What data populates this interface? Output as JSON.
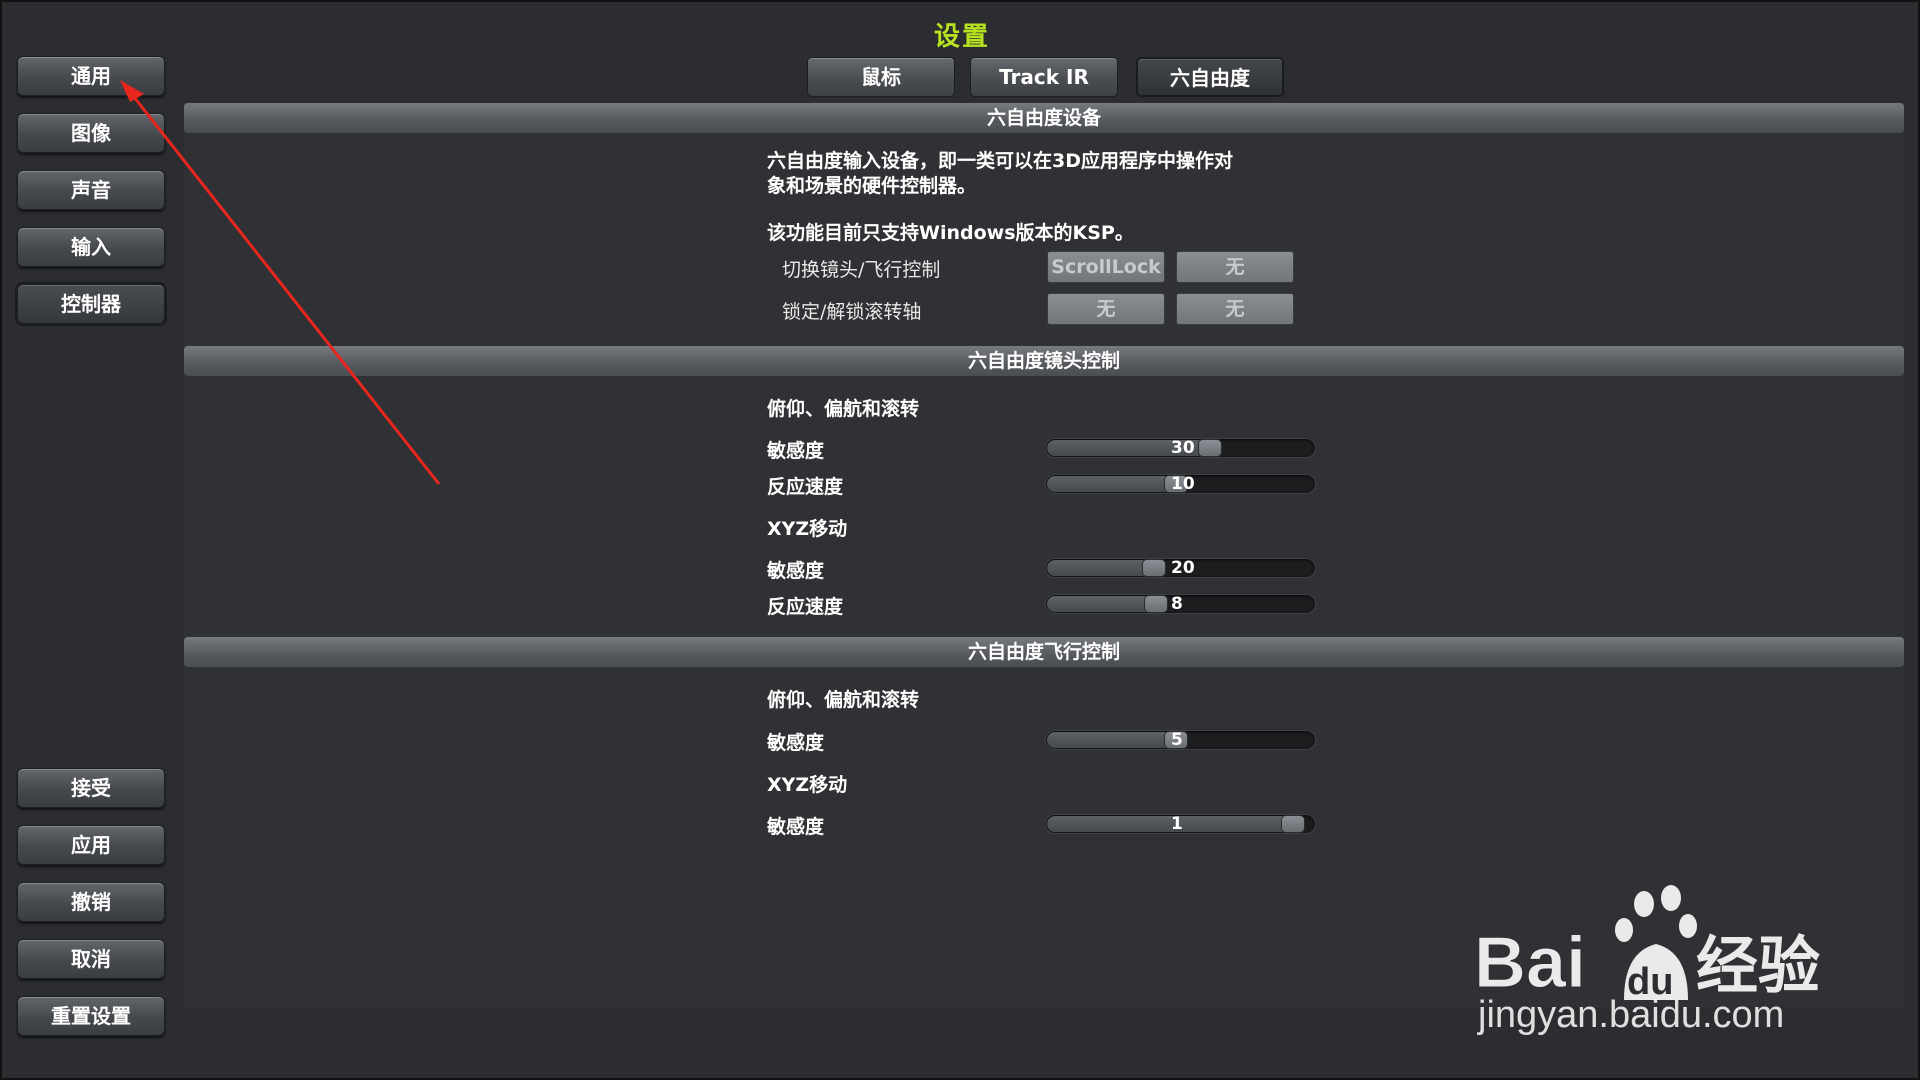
{
  "window": {
    "title": "设置"
  },
  "sidebar": {
    "items": [
      {
        "label": "通用"
      },
      {
        "label": "图像"
      },
      {
        "label": "声音"
      },
      {
        "label": "输入"
      },
      {
        "label": "控制器"
      }
    ],
    "actions": [
      {
        "label": "接受"
      },
      {
        "label": "应用"
      },
      {
        "label": "撤销"
      },
      {
        "label": "取消"
      },
      {
        "label": "重置设置"
      }
    ]
  },
  "tabs": [
    {
      "label": "鼠标"
    },
    {
      "label": "Track IR"
    },
    {
      "label": "六自由度",
      "active": true
    }
  ],
  "device_section": {
    "header": "六自由度设备",
    "desc_line1": "六自由度输入设备，即一类可以在3D应用程序中操作对",
    "desc_line2": "象和场景的硬件控制器。",
    "note": "该功能目前只支持Windows版本的KSP。",
    "bindings": [
      {
        "label": "切换镜头/飞行控制",
        "primary": "ScrollLock",
        "secondary": "无"
      },
      {
        "label": "锁定/解锁滚转轴",
        "primary": "无",
        "secondary": "无"
      }
    ]
  },
  "camera_section": {
    "header": "六自由度镜头控制",
    "rot_title": "俯仰、偏航和滚转",
    "rot_sensitivity_label": "敏感度",
    "rot_sensitivity_value": "30",
    "rot_speed_label": "反应速度",
    "rot_speed_value": "10",
    "xyz_title": "XYZ移动",
    "xyz_sensitivity_label": "敏感度",
    "xyz_sensitivity_value": "20",
    "xyz_speed_label": "反应速度",
    "xyz_speed_value": "8"
  },
  "flight_section": {
    "header": "六自由度飞行控制",
    "rot_title": "俯仰、偏航和滚转",
    "rot_sensitivity_label": "敏感度",
    "rot_sensitivity_value": "5",
    "xyz_title": "XYZ移动",
    "xyz_sensitivity_label": "敏感度",
    "xyz_sensitivity_value": "1"
  },
  "slider_levels": {
    "cam_rot_sens": 0.62,
    "cam_rot_speed": 0.48,
    "cam_xyz_sens": 0.39,
    "cam_xyz_speed": 0.4,
    "flight_rot_sens": 0.48,
    "flight_xyz_sens": 0.96
  },
  "watermark": {
    "logo_text_left": "Bai",
    "logo_text_paw": "du",
    "logo_text_right": "经验",
    "url": "jingyan.baidu.com"
  },
  "colors": {
    "title": "#b8e320",
    "annotation_arrow": "#e8261e"
  }
}
